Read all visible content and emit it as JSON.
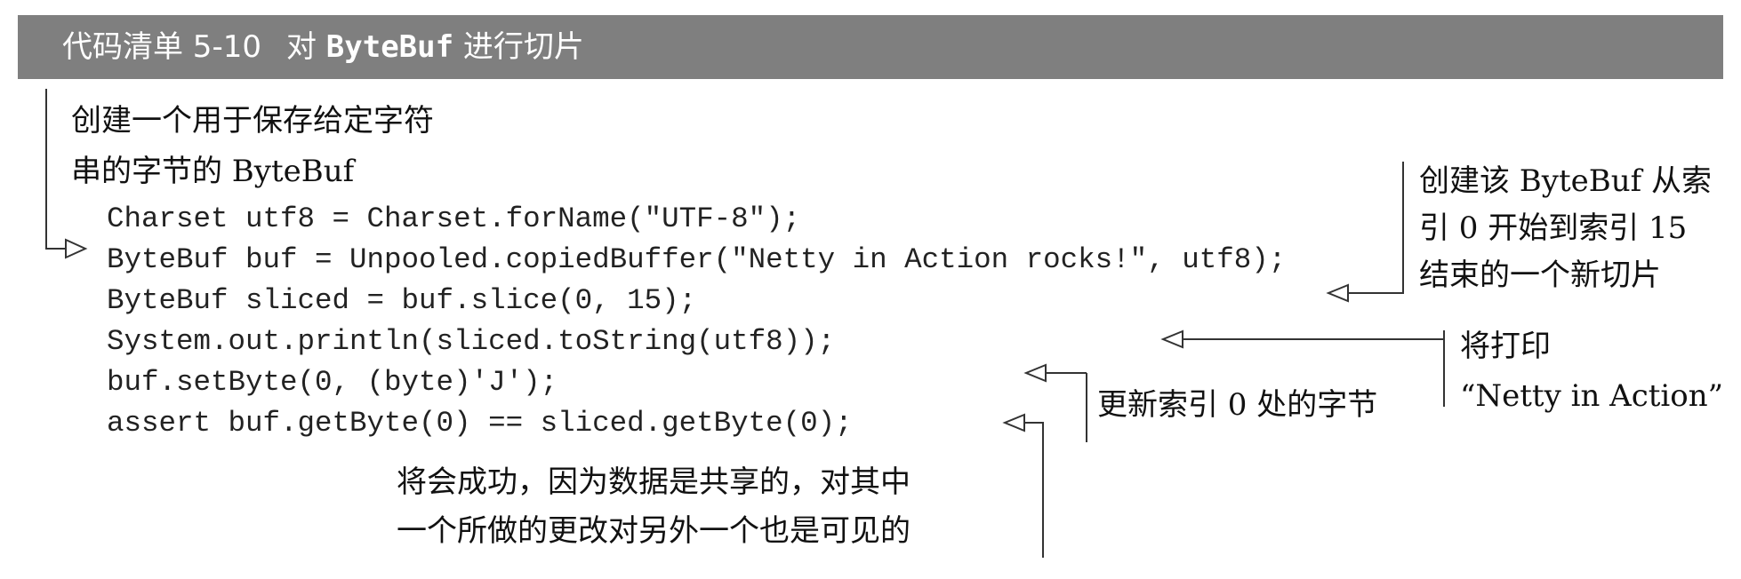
{
  "header": {
    "label": "代码清单 5-10",
    "title_prefix": "对",
    "title_code": "ByteBuf",
    "title_suffix": "进行切片"
  },
  "code_lines": [
    "Charset utf8 = Charset.forName(\"UTF-8\");",
    "ByteBuf buf = Unpooled.copiedBuffer(\"Netty in Action rocks!\", utf8);",
    "ByteBuf sliced = buf.slice(0, 15);",
    "System.out.println(sliced.toString(utf8));",
    "buf.setByte(0, (byte)'J');",
    "assert buf.getByte(0) == sliced.getByte(0);"
  ],
  "annotations": {
    "create_buffer": [
      "创建一个用于保存给定字符",
      "串的字节的 ByteBuf"
    ],
    "create_slice": [
      "创建该 ByteBuf 从索",
      "引 0 开始到索引 15",
      "结束的一个新切片"
    ],
    "will_print": [
      "将打印",
      "“Netty in Action”"
    ],
    "update_byte": [
      "更新索引 0 处的字节"
    ],
    "assert_success": [
      "将会成功，因为数据是共享的，对其中",
      "一个所做的更改对另外一个也是可见的"
    ]
  }
}
